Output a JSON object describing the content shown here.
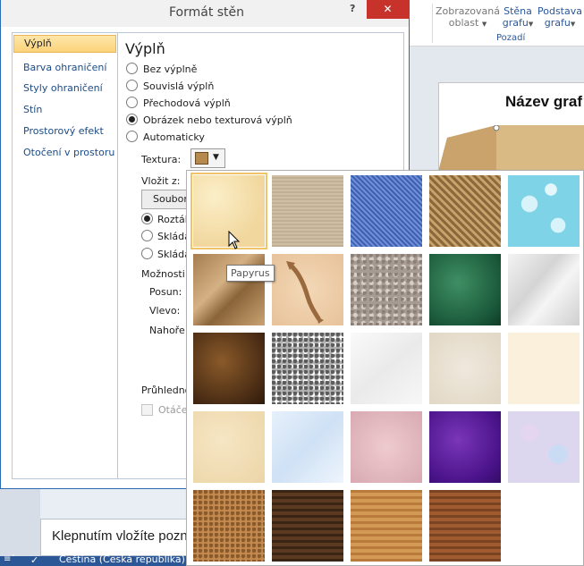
{
  "dialog": {
    "title": "Formát stěn",
    "help_label": "?",
    "close_label": "✕",
    "nav": [
      {
        "label": "Výplň",
        "selected": true
      },
      {
        "label": "Barva ohraničení",
        "selected": false
      },
      {
        "label": "Styly ohraničení",
        "selected": false
      },
      {
        "label": "Stín",
        "selected": false
      },
      {
        "label": "Prostorový efekt",
        "selected": false
      },
      {
        "label": "Otočení v prostoru",
        "selected": false
      }
    ],
    "section_title": "Výplň",
    "fill_options": [
      {
        "label": "Bez výplně",
        "checked": false
      },
      {
        "label": "Souvislá výplň",
        "checked": false
      },
      {
        "label": "Přechodová výplň",
        "checked": false
      },
      {
        "label": "Obrázek nebo texturová výplň",
        "checked": true
      },
      {
        "label": "Automaticky",
        "checked": false
      }
    ],
    "texture_label": "Textura:",
    "insert_from_label": "Vložit z:",
    "file_button_label": "Soubor...",
    "tile_options": [
      {
        "label": "Roztáh",
        "checked": true
      },
      {
        "label": "Skládat",
        "checked": false
      },
      {
        "label": "Skládat",
        "checked": false
      }
    ],
    "options_label": "Možnosti ro",
    "offset_label": "Posun:",
    "left_label": "Vlevo:",
    "top_label": "Nahoře:",
    "transparency_label": "Průhlednos",
    "rotate_label": "Otáčet",
    "rotate_checked": false,
    "rotate_enabled": false
  },
  "texture_gallery": {
    "tooltip": "Papyrus",
    "selected": "Papyrus",
    "tiles": [
      {
        "icon": "papyrus"
      },
      {
        "icon": "canvas"
      },
      {
        "icon": "denim"
      },
      {
        "icon": "woven-mat"
      },
      {
        "icon": "water-droplets"
      },
      {
        "icon": "paper-bag"
      },
      {
        "icon": "fish-fossil"
      },
      {
        "icon": "granite"
      },
      {
        "icon": "green-marble"
      },
      {
        "icon": "white-marble"
      },
      {
        "icon": "brown-marble"
      },
      {
        "icon": "gravel"
      },
      {
        "icon": "recycled-paper"
      },
      {
        "icon": "sand"
      },
      {
        "icon": "parchment"
      },
      {
        "icon": "stationery"
      },
      {
        "icon": "blue-tissue-paper"
      },
      {
        "icon": "pink-tissue-paper"
      },
      {
        "icon": "purple-mesh"
      },
      {
        "icon": "bouquet"
      },
      {
        "icon": "cork"
      },
      {
        "icon": "walnut"
      },
      {
        "icon": "oak"
      },
      {
        "icon": "medium-wood"
      }
    ]
  },
  "ribbon": {
    "zobrazovana_line1": "Zobrazovaná",
    "zobrazovana_line2": "oblast",
    "stena_line1": "Stěna",
    "stena_line2": "grafu",
    "podstava_line1": "Podstava",
    "podstava_line2": "grafu",
    "group_label": "Pozadí"
  },
  "chart": {
    "title": "Název graf"
  },
  "slide": {
    "note": "Klepnutím vložíte pozn"
  },
  "status": {
    "language": "Čeština (Česká republika)"
  },
  "colors": {
    "accent": "#2b579a",
    "close": "#c7322b",
    "selection": "#fcd37a"
  }
}
